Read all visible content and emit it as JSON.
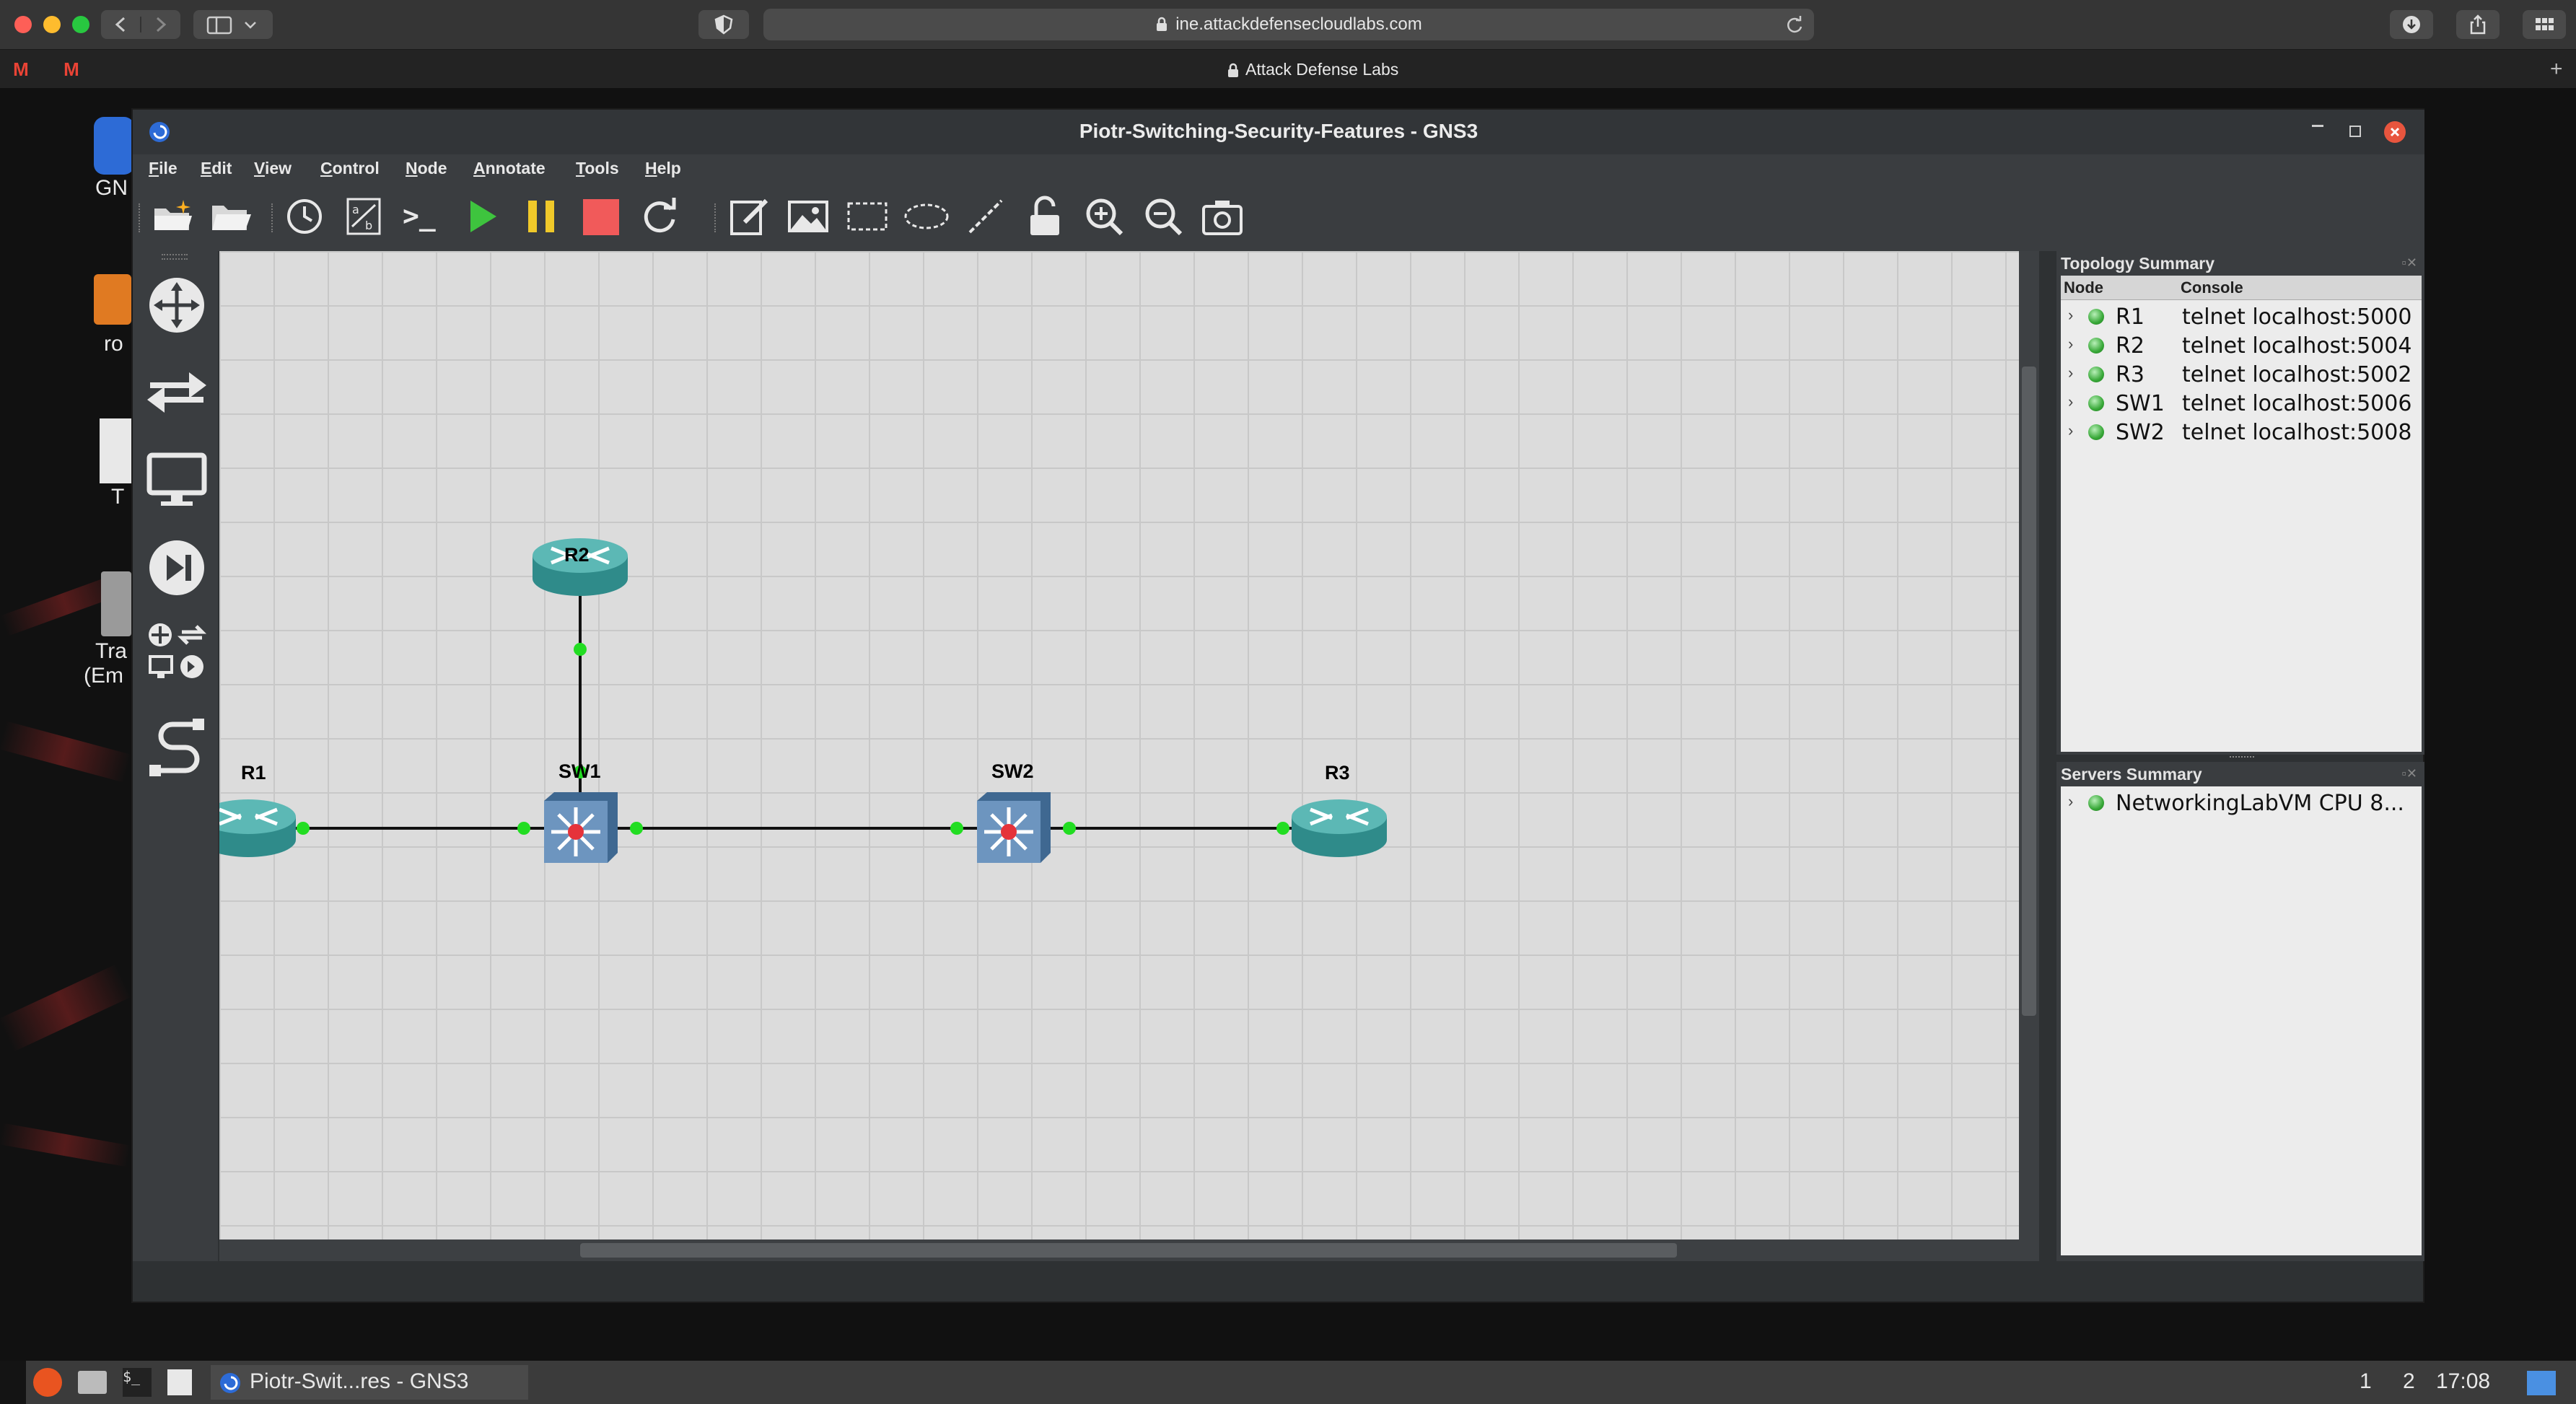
{
  "browser": {
    "url": "ine.attackdefensecloudlabs.com",
    "tab_title": "Attack Defense Labs"
  },
  "desktop": {
    "icons": [
      {
        "label": "GN"
      },
      {
        "label": "ro"
      },
      {
        "label": "T"
      },
      {
        "label": "Tra"
      },
      {
        "label": "(Em"
      }
    ]
  },
  "window": {
    "title": "Piotr-Switching-Security-Features - GNS3"
  },
  "menu": [
    {
      "first": "F",
      "rest": "ile"
    },
    {
      "first": "E",
      "rest": "dit"
    },
    {
      "first": "V",
      "rest": "iew"
    },
    {
      "first": "C",
      "rest": "ontrol"
    },
    {
      "first": "N",
      "rest": "ode"
    },
    {
      "first": "A",
      "rest": "nnotate"
    },
    {
      "first": "T",
      "rest": "ools"
    },
    {
      "first": "H",
      "rest": "elp"
    }
  ],
  "toolbar": {
    "console_glyph": ">_"
  },
  "topology": {
    "nodes": [
      {
        "label": "R1",
        "type": "router"
      },
      {
        "label": "R2",
        "type": "router"
      },
      {
        "label": "R3",
        "type": "router"
      },
      {
        "label": "SW1",
        "type": "switch"
      },
      {
        "label": "SW2",
        "type": "switch"
      }
    ],
    "links": [
      [
        "R1",
        "SW1"
      ],
      [
        "R2",
        "SW1"
      ],
      [
        "SW1",
        "SW2"
      ],
      [
        "SW2",
        "R3"
      ]
    ],
    "link_status_color": "#22dd22"
  },
  "topology_summary": {
    "title": "Topology Summary",
    "headers": {
      "node": "Node",
      "console": "Console"
    },
    "rows": [
      {
        "node": "R1",
        "console": "telnet localhost:5000"
      },
      {
        "node": "R2",
        "console": "telnet localhost:5004"
      },
      {
        "node": "R3",
        "console": "telnet localhost:5002"
      },
      {
        "node": "SW1",
        "console": "telnet localhost:5006"
      },
      {
        "node": "SW2",
        "console": "telnet localhost:5008"
      }
    ]
  },
  "servers_summary": {
    "title": "Servers Summary",
    "rows": [
      {
        "name": "NetworkingLabVM CPU 8..."
      }
    ]
  },
  "taskbar": {
    "active_task": "Piotr-Swit...res - GNS3",
    "workspace_1": "1",
    "workspace_2": "2",
    "clock": "17:08"
  }
}
